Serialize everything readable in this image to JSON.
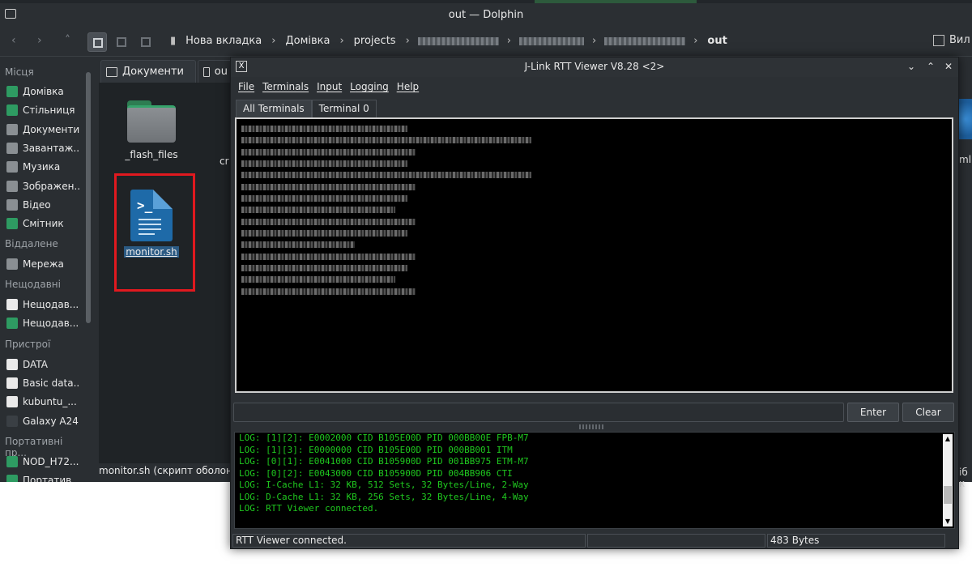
{
  "dolphin": {
    "title": "out — Dolphin",
    "breadcrumbs": [
      "Нова вкладка",
      "Домівка",
      "projects",
      "out"
    ],
    "split_label": "Вил",
    "places": {
      "headings": [
        "Місця",
        "Віддалене",
        "Нещодавні",
        "Пристрої",
        "Портативні пр..."
      ],
      "items": [
        {
          "label": "Домівка",
          "icon": "home-icon",
          "color": "#2e9b62"
        },
        {
          "label": "Стільниця",
          "icon": "desktop-icon",
          "color": "#2e9b62"
        },
        {
          "label": "Документи",
          "icon": "documents-icon",
          "color": "#8a8f93"
        },
        {
          "label": "Завантаж...",
          "icon": "downloads-icon",
          "color": "#8a8f93"
        },
        {
          "label": "Музика",
          "icon": "music-icon",
          "color": "#8a8f93"
        },
        {
          "label": "Зображен...",
          "icon": "pictures-icon",
          "color": "#8a8f93"
        },
        {
          "label": "Відео",
          "icon": "videos-icon",
          "color": "#8a8f93"
        },
        {
          "label": "Смітник",
          "icon": "trash-icon",
          "color": "#2e9b62"
        },
        {
          "label": "Мережа",
          "icon": "network-icon",
          "color": "#8a8f93"
        },
        {
          "label": "Нещодав...",
          "icon": "recent-files-icon",
          "color": "#eaeaea"
        },
        {
          "label": "Нещодав...",
          "icon": "recent-locations-icon",
          "color": "#2e9b62"
        },
        {
          "label": "DATA",
          "icon": "drive-icon",
          "color": "#eaeaea"
        },
        {
          "label": "Basic data...",
          "icon": "drive-icon",
          "color": "#eaeaea"
        },
        {
          "label": "kubuntu_...",
          "icon": "drive-icon",
          "color": "#eaeaea"
        },
        {
          "label": "Galaxy A24",
          "icon": "phone-icon",
          "color": "#3a3f44"
        },
        {
          "label": "NOD_H72...",
          "icon": "usb-icon",
          "color": "#2e9b62"
        },
        {
          "label": "Портатив...",
          "icon": "usb-icon",
          "color": "#2e9b62"
        }
      ]
    },
    "tabs": [
      "Документи",
      "ou"
    ],
    "files": [
      {
        "name": "_flash_files"
      },
      {
        "name": "monitor.sh"
      }
    ],
    "partial_file_label": "cr",
    "right_partial_label": "ml",
    "right_partial_status": "іб к",
    "status_text": "monitor.sh (скрипт оболонки"
  },
  "jlink": {
    "title": "J-Link RTT Viewer V8.28 <2>",
    "menu": [
      "File",
      "Terminals",
      "Input",
      "Logging",
      "Help"
    ],
    "tabs": [
      "All Terminals",
      "Terminal 0"
    ],
    "buttons": {
      "enter": "Enter",
      "clear": "Clear"
    },
    "log_lines": [
      "LOG: [1][2]: E0002000 CID B105E00D PID 000BB00E FPB-M7",
      "LOG: [1][3]: E0000000 CID B105E00D PID 000BB001 ITM",
      "LOG: [0][1]: E0041000 CID B105900D PID 001BB975 ETM-M7",
      "LOG: [0][2]: E0043000 CID B105900D PID 004BB906 CTI",
      "LOG: I-Cache L1: 32 KB, 512 Sets, 32 Bytes/Line, 2-Way",
      "LOG: D-Cache L1: 32 KB, 256 Sets, 32 Bytes/Line, 4-Way",
      "LOG: RTT Viewer connected."
    ],
    "status": {
      "message": "RTT Viewer connected.",
      "middle": "",
      "bytes": "483 Bytes"
    }
  },
  "colors": {
    "terminal_bg": "#000000",
    "log_text": "#1fc81f",
    "selection_outline": "#e0191f",
    "window_bg": "#2a2e32"
  }
}
